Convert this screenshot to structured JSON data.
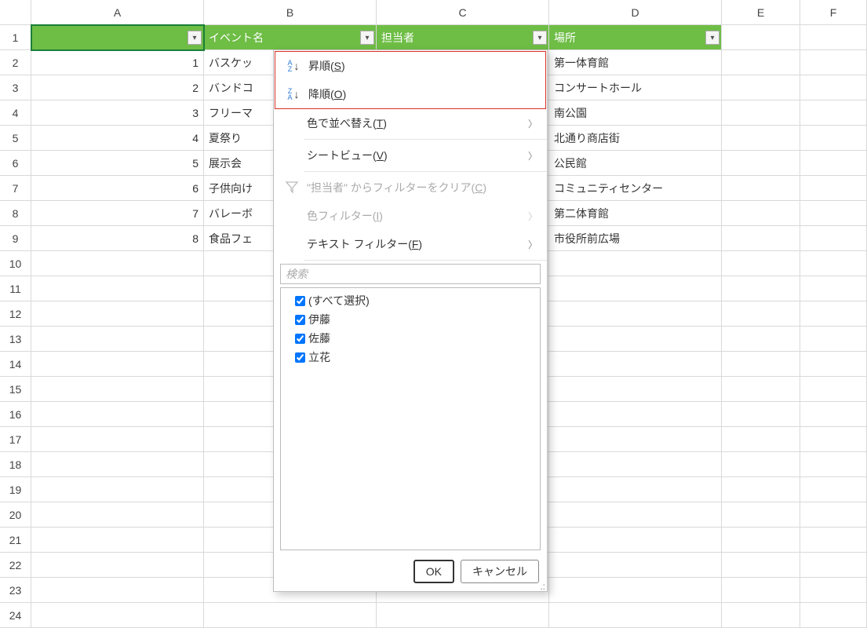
{
  "columns": [
    "A",
    "B",
    "C",
    "D",
    "E",
    "F"
  ],
  "rows_count": 24,
  "headers": {
    "a": "",
    "b": "イベント名",
    "c": "担当者",
    "d": "場所"
  },
  "table": [
    {
      "a": "1",
      "b": "バスケッ",
      "d": "第一体育館"
    },
    {
      "a": "2",
      "b": "バンドコ",
      "d": "コンサートホール"
    },
    {
      "a": "3",
      "b": "フリーマ",
      "d": "南公園"
    },
    {
      "a": "4",
      "b": "夏祭り",
      "d": "北通り商店街"
    },
    {
      "a": "5",
      "b": "展示会",
      "d": "公民館"
    },
    {
      "a": "6",
      "b": "子供向け",
      "d": "コミュニティセンター"
    },
    {
      "a": "7",
      "b": "バレーボ",
      "d": "第二体育館"
    },
    {
      "a": "8",
      "b": "食品フェ",
      "d": "市役所前広場"
    }
  ],
  "dropdown": {
    "sort_asc": "昇順(",
    "sort_asc_key": "S",
    "sort_asc_end": ")",
    "sort_desc": "降順(",
    "sort_desc_key": "O",
    "sort_desc_end": ")",
    "sort_color": "色で並べ替え(",
    "sort_color_key": "T",
    "sort_color_end": ")",
    "sheet_view": "シートビュー(",
    "sheet_view_key": "V",
    "sheet_view_end": ")",
    "clear_filter": "\"担当者\" からフィルターをクリア(",
    "clear_filter_key": "C",
    "clear_filter_end": ")",
    "color_filter": "色フィルター(",
    "color_filter_key": "I",
    "color_filter_end": ")",
    "text_filter": "テキスト フィルター(",
    "text_filter_key": "F",
    "text_filter_end": ")",
    "search_placeholder": "検索",
    "checks": [
      "(すべて選択)",
      "伊藤",
      "佐藤",
      "立花"
    ],
    "ok": "OK",
    "cancel": "キャンセル"
  }
}
